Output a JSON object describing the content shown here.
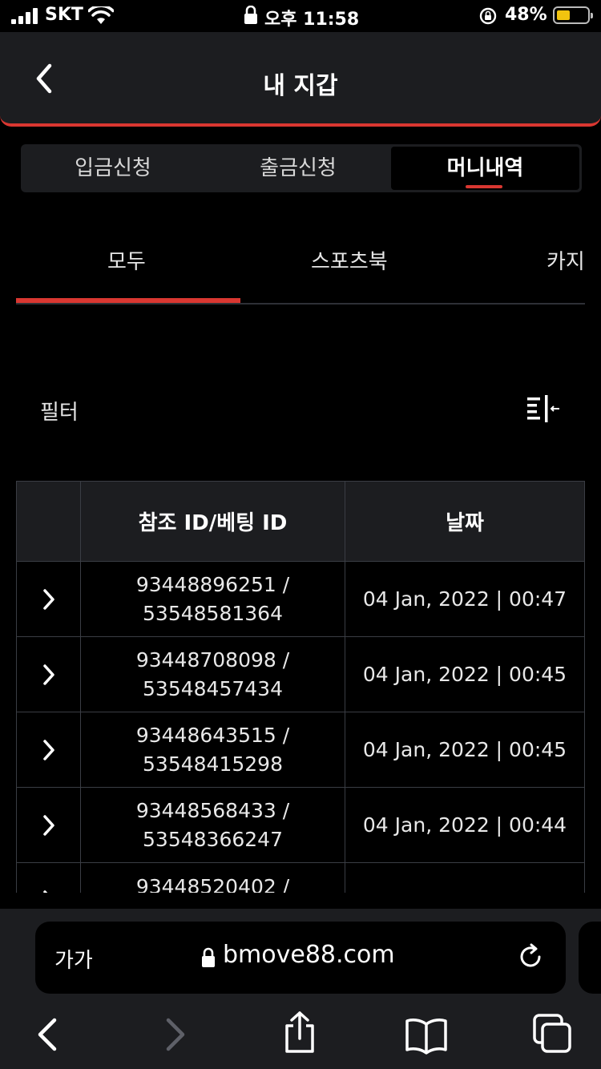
{
  "status_bar": {
    "carrier": "SKT",
    "time": "오후 11:58",
    "battery": "48%"
  },
  "header": {
    "title": "내 지갑"
  },
  "segmented_tabs": [
    {
      "label": "입금신청",
      "active": false
    },
    {
      "label": "출금신청",
      "active": false
    },
    {
      "label": "머니내역",
      "active": true
    }
  ],
  "category_tabs": [
    {
      "label": "모두",
      "active": true
    },
    {
      "label": "스포츠북",
      "active": false
    },
    {
      "label": "카지",
      "active": false
    }
  ],
  "filter": {
    "label": "필터"
  },
  "table": {
    "columns": [
      "",
      "참조 ID/베팅 ID",
      "날짜"
    ],
    "rows": [
      {
        "ref_id": "93448896251 /",
        "bet_id": "53548581364",
        "date": "04 Jan, 2022 | 00:47"
      },
      {
        "ref_id": "93448708098 /",
        "bet_id": "53548457434",
        "date": "04 Jan, 2022 | 00:45"
      },
      {
        "ref_id": "93448643515 /",
        "bet_id": "53548415298",
        "date": "04 Jan, 2022 | 00:45"
      },
      {
        "ref_id": "93448568433 /",
        "bet_id": "53548366247",
        "date": "04 Jan, 2022 | 00:44"
      },
      {
        "ref_id": "93448520402 /",
        "bet_id": "",
        "date": ""
      }
    ]
  },
  "browser": {
    "text_size_button": "가가",
    "url": "bmove88.com"
  },
  "colors": {
    "accent": "#d93731",
    "header_bg": "#1c1d20",
    "background": "#000000"
  }
}
